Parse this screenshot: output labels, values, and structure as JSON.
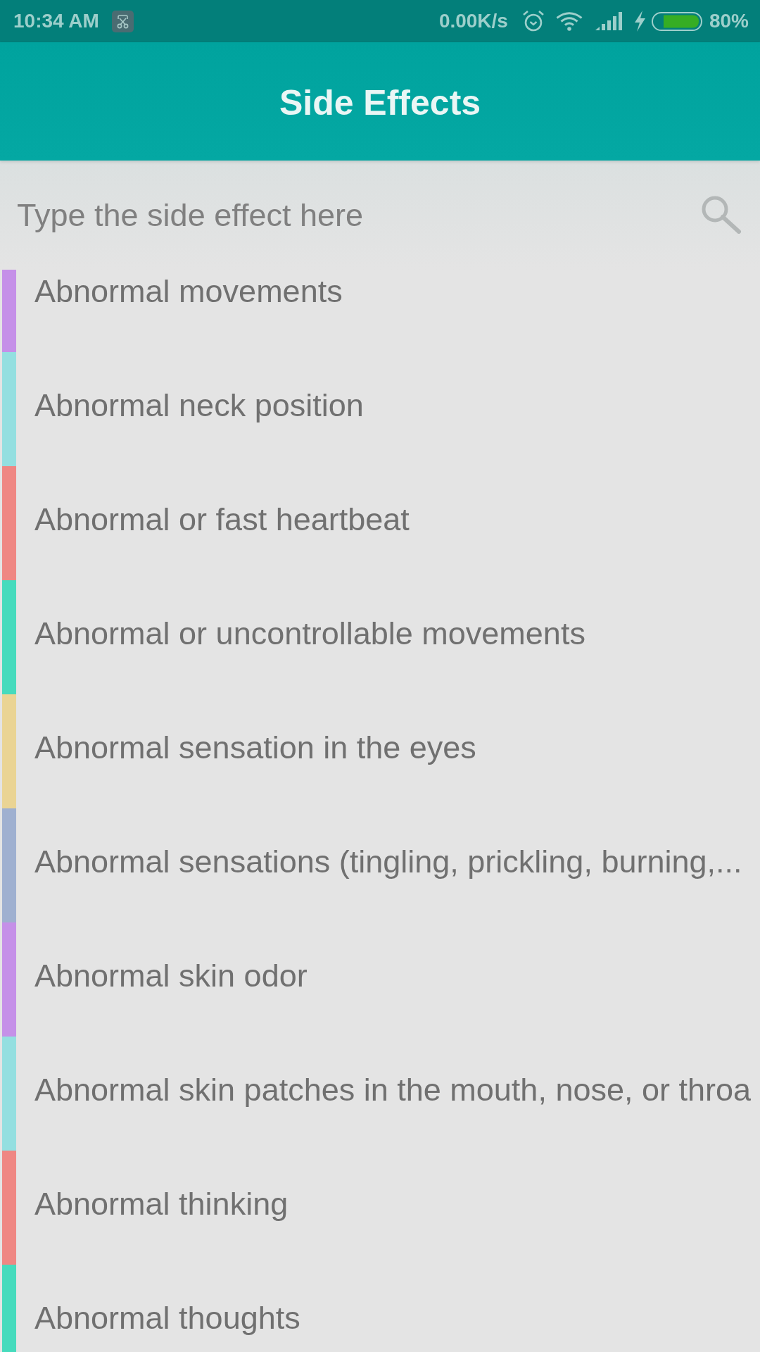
{
  "status_bar": {
    "time": "10:34 AM",
    "network_speed": "0.00K/s",
    "battery": "80%"
  },
  "app_bar": {
    "title": "Side Effects"
  },
  "search": {
    "placeholder": "Type the side effect here"
  },
  "items": [
    {
      "label": "Abnormal movements",
      "color": "#c590e8"
    },
    {
      "label": "Abnormal neck position",
      "color": "#94dfe0"
    },
    {
      "label": "Abnormal or fast heartbeat",
      "color": "#ef8783"
    },
    {
      "label": "Abnormal or uncontrollable movements",
      "color": "#46dbbd"
    },
    {
      "label": "Abnormal sensation in the eyes",
      "color": "#ead494"
    },
    {
      "label": "Abnormal sensations (tingling, prickling, burning,...",
      "color": "#9fb0d0"
    },
    {
      "label": "Abnormal skin odor",
      "color": "#c590e8"
    },
    {
      "label": "Abnormal skin patches in the mouth, nose, or throa",
      "color": "#94dfe0"
    },
    {
      "label": "Abnormal thinking",
      "color": "#ef8783"
    },
    {
      "label": "Abnormal thoughts",
      "color": "#46dbbd"
    }
  ]
}
